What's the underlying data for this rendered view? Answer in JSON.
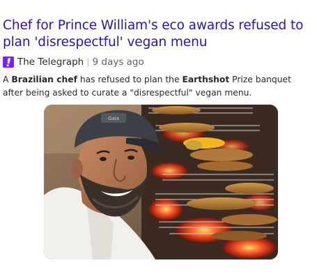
{
  "article": {
    "headline": "Chef for Prince William's eco awards refused to plan 'disrespectful' vegan menu",
    "source": {
      "icon": "yahoo-exclamation-icon",
      "name": "The Telegraph",
      "separator": "|",
      "time": "9 days ago"
    },
    "summary": {
      "s1": "A ",
      "b1": "Brazilian chef",
      "s2": " has refused to plan the ",
      "b2": "Earthshot",
      "s3": " Prize banquet after being asked to curate a \"disrespectful\" vegan menu."
    },
    "image": {
      "cap_text": "Gaia"
    }
  },
  "colors": {
    "headline": "#2a14a8",
    "provider_icon_bg": "#7e1fff",
    "text": "#232a31",
    "muted": "#5b636a"
  }
}
